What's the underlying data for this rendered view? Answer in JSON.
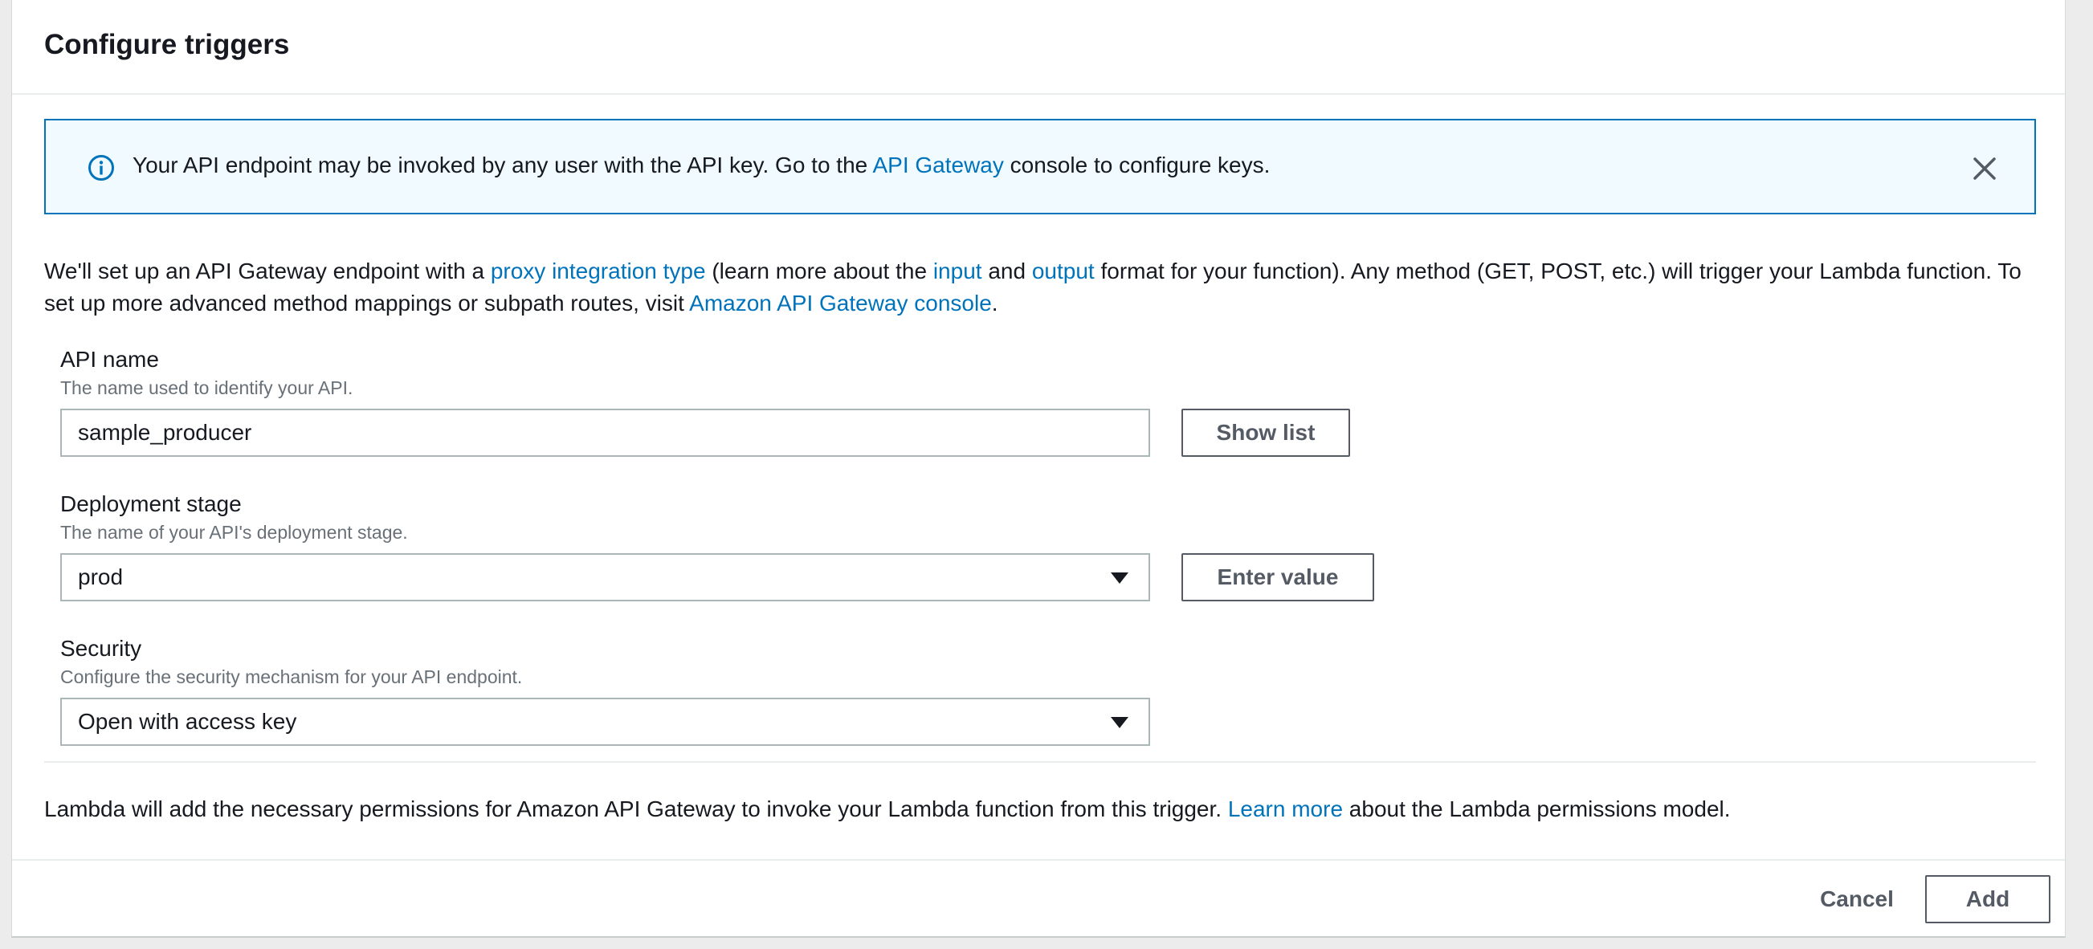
{
  "panel": {
    "title": "Configure triggers"
  },
  "alert": {
    "text_before": "Your API endpoint may be invoked by any user with the API key. Go to the ",
    "link": "API Gateway",
    "text_after": " console to configure keys.",
    "icon": "info-icon",
    "close_icon": "close-icon"
  },
  "intro": {
    "t1": "We'll set up an API Gateway endpoint with a ",
    "link_proxy": "proxy integration type",
    "t2": " (learn more about the ",
    "link_input": "input",
    "t3": " and ",
    "link_output": "output",
    "t4": " format for your function). Any method (GET, POST, etc.) will trigger your Lambda function. To set up more advanced method mappings or subpath routes, visit ",
    "link_console": "Amazon API Gateway console",
    "t5": "."
  },
  "api_name": {
    "label": "API name",
    "description": "The name used to identify your API.",
    "value": "sample_producer",
    "button": "Show list"
  },
  "deployment_stage": {
    "label": "Deployment stage",
    "description": "The name of your API's deployment stage.",
    "value": "prod",
    "button": "Enter value"
  },
  "security": {
    "label": "Security",
    "description": "Configure the security mechanism for your API endpoint.",
    "value": "Open with access key"
  },
  "footer_note": {
    "t1": "Lambda will add the necessary permissions for Amazon API Gateway to invoke your Lambda function from this trigger. ",
    "link": "Learn more",
    "t2": " about the Lambda permissions model."
  },
  "actions": {
    "cancel": "Cancel",
    "add": "Add"
  },
  "colors": {
    "link": "#0073bb",
    "alert_bg": "#f1faff",
    "alert_border": "#0073bb",
    "muted_text": "#687078",
    "button_text": "#545b64"
  }
}
